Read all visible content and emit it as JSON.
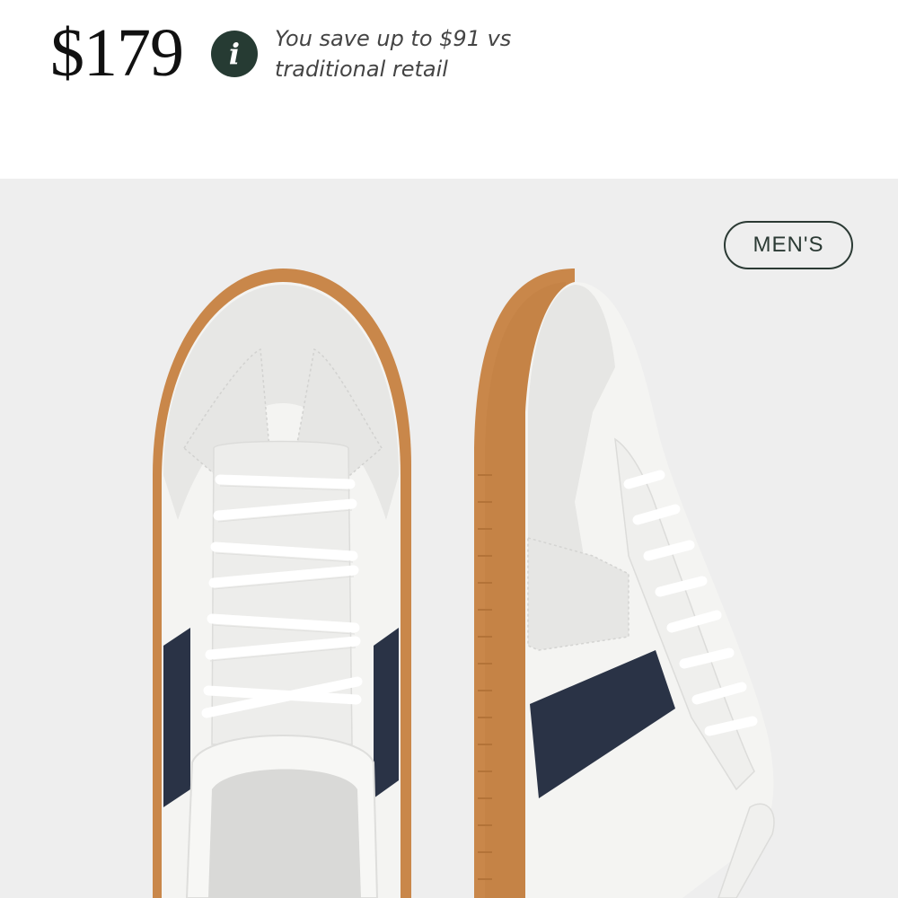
{
  "product": {
    "price": "$179",
    "savings_text": "You save up to $91 vs traditional retail",
    "info_icon": "info-icon",
    "gender_badge": "MEN'S"
  },
  "colors": {
    "info_icon_bg": "#263b33",
    "gallery_bg": "#eeeeee",
    "sole": "#c9874a",
    "stripe": "#2a3346",
    "leather": "#f6f6f4"
  }
}
